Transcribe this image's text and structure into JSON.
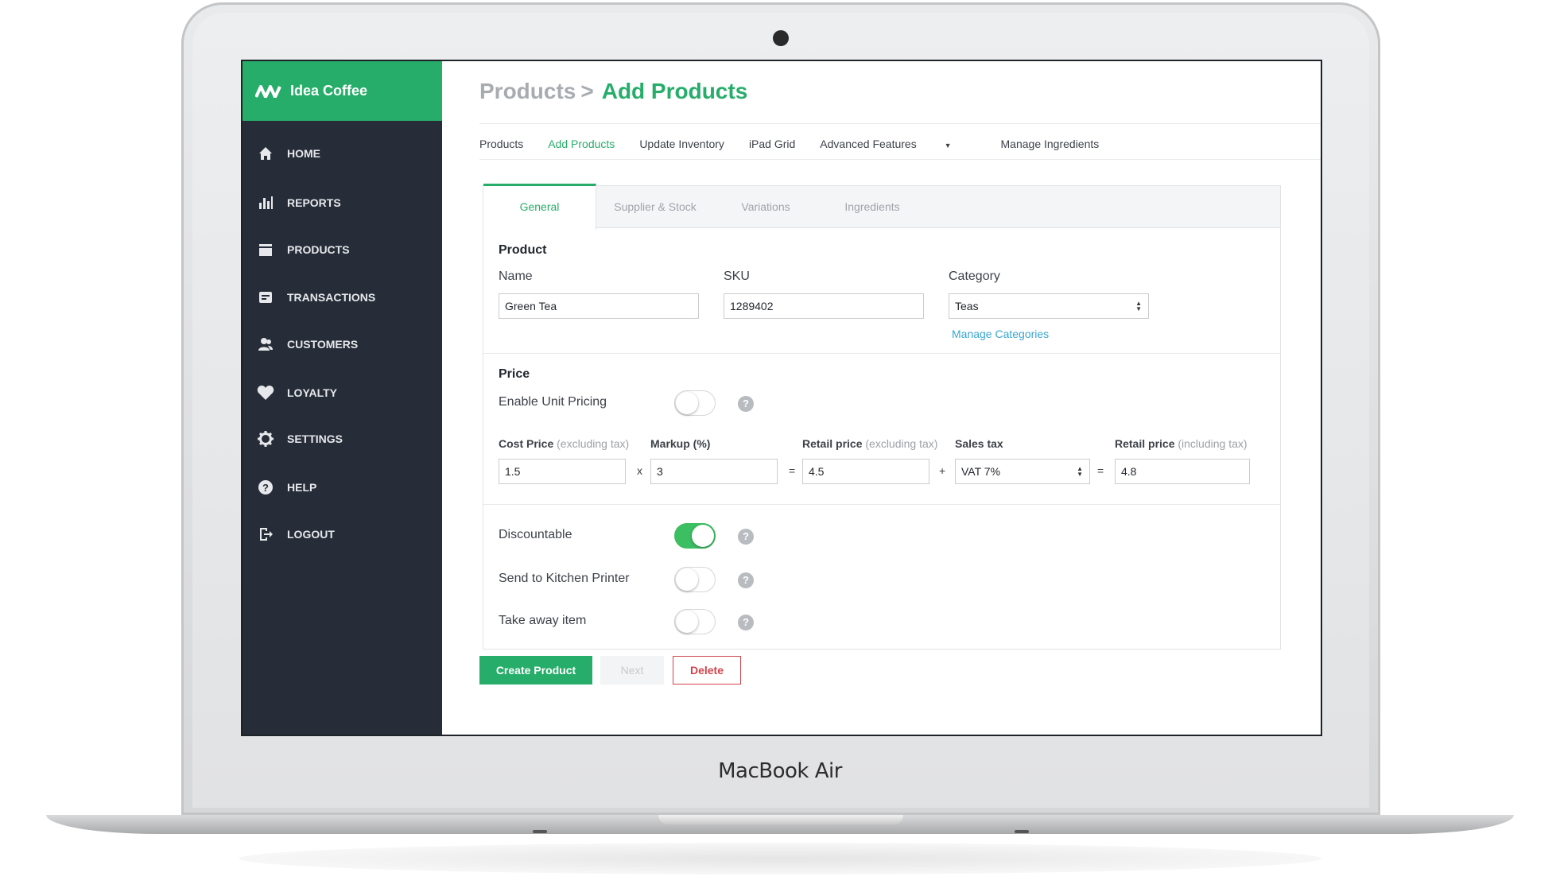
{
  "device": {
    "model_label": "MacBook Air"
  },
  "sidebar": {
    "brand": "Idea Coffee",
    "items": [
      {
        "label": "HOME",
        "icon": "home-icon"
      },
      {
        "label": "REPORTS",
        "icon": "reports-icon"
      },
      {
        "label": "PRODUCTS",
        "icon": "products-icon"
      },
      {
        "label": "TRANSACTIONS",
        "icon": "transactions-icon"
      },
      {
        "label": "CUSTOMERS",
        "icon": "customers-icon"
      },
      {
        "label": "LOYALTY",
        "icon": "heart-icon"
      },
      {
        "label": "SETTINGS",
        "icon": "gear-icon"
      },
      {
        "label": "HELP",
        "icon": "help-icon"
      },
      {
        "label": "LOGOUT",
        "icon": "logout-icon"
      }
    ]
  },
  "header": {
    "breadcrumb_parent": "Products",
    "breadcrumb_sep": ">",
    "breadcrumb_current": "Add Products"
  },
  "subnav": {
    "items": [
      "Products",
      "Add Products",
      "Update Inventory",
      "iPad Grid",
      "Advanced Features",
      "Manage Ingredients"
    ],
    "active_index": 1
  },
  "tabs": {
    "items": [
      "General",
      "Supplier & Stock",
      "Variations",
      "Ingredients"
    ],
    "active_index": 0
  },
  "product": {
    "section_title": "Product",
    "name_label": "Name",
    "name_value": "Green Tea",
    "sku_label": "SKU",
    "sku_value": "1289402",
    "category_label": "Category",
    "category_value": "Teas",
    "manage_categories": "Manage Categories"
  },
  "price": {
    "section_title": "Price",
    "unit_pricing_label": "Enable Unit Pricing",
    "unit_pricing_on": false,
    "cost_label": "Cost Price",
    "cost_hint": "(excluding tax)",
    "cost_value": "1.5",
    "op_times": "x",
    "markup_label": "Markup (%)",
    "markup_value": "3",
    "op_equals": "=",
    "retail_ex_label": "Retail price",
    "retail_ex_hint": "(excluding tax)",
    "retail_ex_value": "4.5",
    "op_plus": "+",
    "tax_label": "Sales tax",
    "tax_value": "VAT 7%",
    "retail_in_label": "Retail price",
    "retail_in_hint": "(including tax)",
    "retail_in_value": "4.8"
  },
  "options": {
    "discountable_label": "Discountable",
    "discountable_on": true,
    "kitchen_label": "Send to Kitchen Printer",
    "kitchen_on": false,
    "takeaway_label": "Take away item",
    "takeaway_on": false,
    "help_glyph": "?"
  },
  "actions": {
    "create": "Create Product",
    "next": "Next",
    "delete": "Delete"
  },
  "colors": {
    "accent": "#27ad6a",
    "sidebar_bg": "#262d38",
    "toggle_on": "#3cbf62",
    "link": "#3aa6d3",
    "danger": "#d0444b"
  }
}
